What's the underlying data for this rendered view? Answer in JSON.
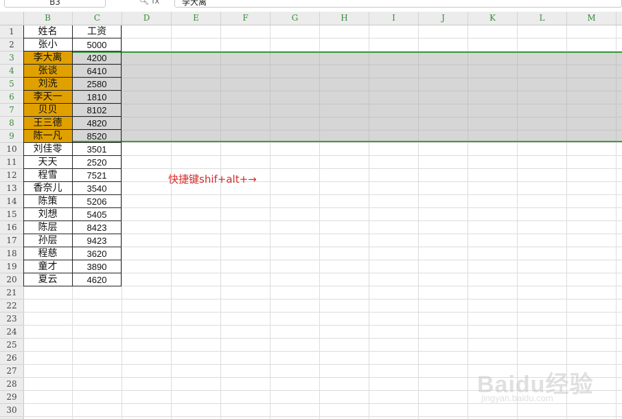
{
  "formula_bar": {
    "name_box": "B3",
    "fx_label": "fx",
    "content": "李大离"
  },
  "columns": [
    "B",
    "C",
    "D",
    "E",
    "F",
    "G",
    "H",
    "I",
    "J",
    "K",
    "L",
    "M"
  ],
  "rows": [
    "1",
    "2",
    "3",
    "4",
    "5",
    "6",
    "7",
    "8",
    "9",
    "10",
    "11",
    "12",
    "13",
    "14",
    "15",
    "16",
    "17",
    "18",
    "19",
    "20",
    "21",
    "22",
    "23",
    "24",
    "25",
    "26",
    "27",
    "28",
    "29",
    "30"
  ],
  "table": {
    "header": {
      "name": "姓名",
      "salary": "工资"
    },
    "records": [
      {
        "name": "张小",
        "salary": "5000"
      },
      {
        "name": "李大离",
        "salary": "4200"
      },
      {
        "name": "张谈",
        "salary": "6410"
      },
      {
        "name": "刘洗",
        "salary": "2580"
      },
      {
        "name": "李天一",
        "salary": "1810"
      },
      {
        "name": "贝贝",
        "salary": "8102"
      },
      {
        "name": "王三德",
        "salary": "4820"
      },
      {
        "name": "陈一凡",
        "salary": "8520"
      },
      {
        "name": "刘佳零",
        "salary": "3501"
      },
      {
        "name": "天天",
        "salary": "2520"
      },
      {
        "name": "程雪",
        "salary": "7521"
      },
      {
        "name": "香奈儿",
        "salary": "3540"
      },
      {
        "name": "陈策",
        "salary": "5206"
      },
      {
        "name": "刘想",
        "salary": "5405"
      },
      {
        "name": "陈层",
        "salary": "8423"
      },
      {
        "name": "孙层",
        "salary": "9423"
      },
      {
        "name": "程慈",
        "salary": "3620"
      },
      {
        "name": "童才",
        "salary": "3890"
      },
      {
        "name": "夏云",
        "salary": "4620"
      }
    ]
  },
  "annotation": "快捷键shif+alt+→",
  "watermark": {
    "main": "Baidu经验",
    "sub": "jingyan.baidu.com"
  },
  "colors": {
    "highlight": "#e0a000",
    "selection_border": "#3f9a3f",
    "annotation": "#d42b2b"
  }
}
